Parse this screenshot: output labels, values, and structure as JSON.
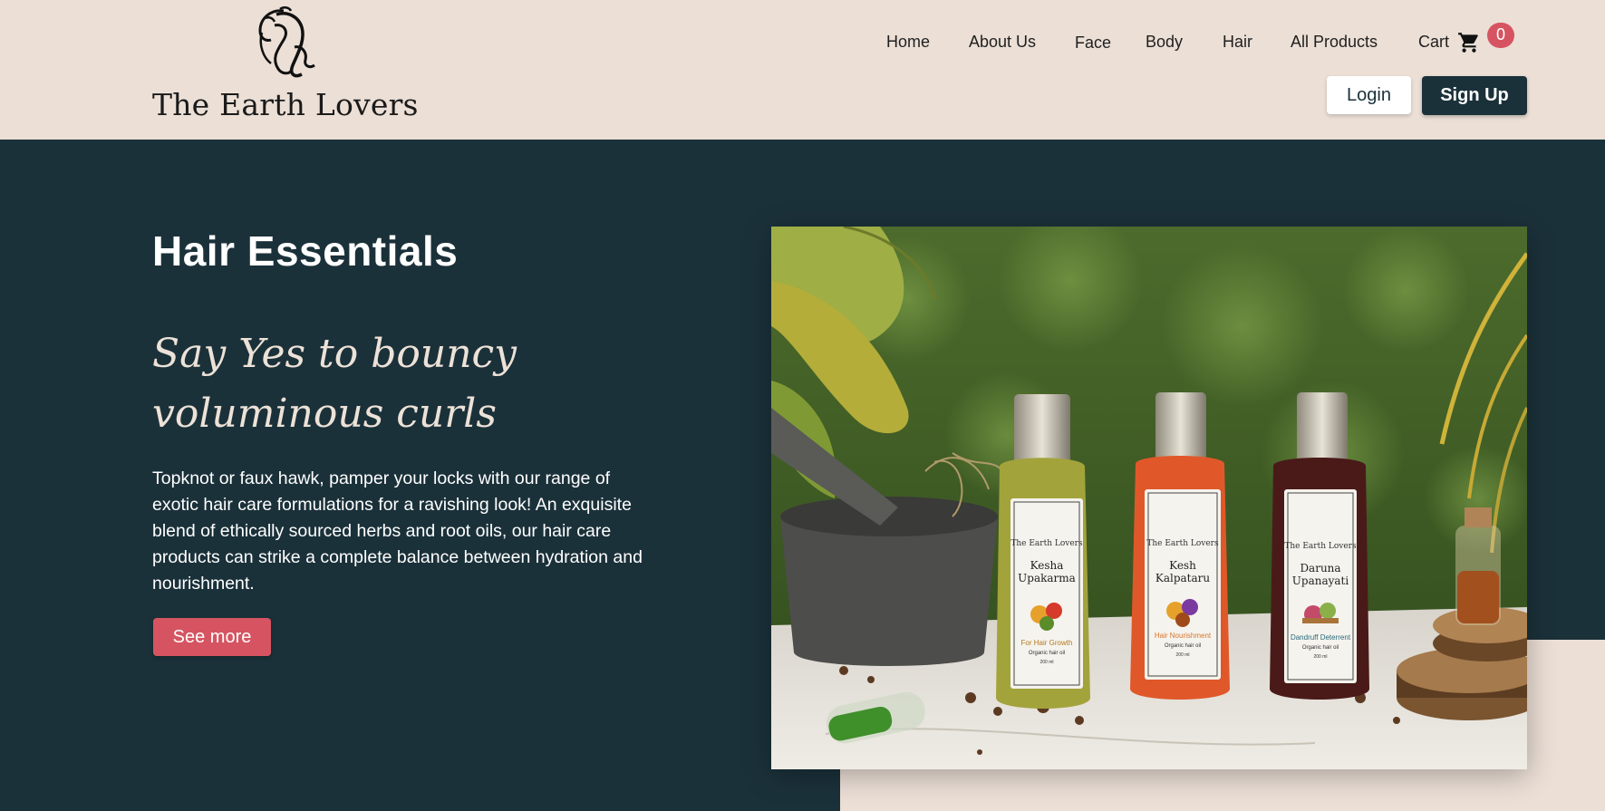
{
  "brand": {
    "name": "The Earth Lovers",
    "logo_icon": "woman-silhouette-logo"
  },
  "nav": {
    "items": [
      "Home",
      "About Us",
      "Face",
      "Body",
      "Hair",
      "All Products"
    ],
    "cart_label": "Cart",
    "cart_icon": "shopping-cart-icon",
    "cart_count": "0"
  },
  "auth": {
    "login_label": "Login",
    "signup_label": "Sign Up"
  },
  "hero": {
    "title": "Hair Essentials",
    "tagline": "Say Yes to bouncy voluminous curls",
    "body": "Topknot or faux hawk, pamper your locks with our range of exotic hair care formulations for a ravishing look! An exquisite blend of ethically sourced herbs and root oils, our hair care products can strike a complete balance between hydration and nourishment.",
    "cta_label": "See more"
  },
  "products": [
    {
      "brand": "The Earth Lovers",
      "name_line1": "Kesha",
      "name_line2": "Upakarma",
      "benefit": "For Hair Growth",
      "type": "Organic hair oil",
      "volume": "200 ml",
      "oil_color": "#a3a33c"
    },
    {
      "brand": "The Earth Lovers",
      "name_line1": "Kesh",
      "name_line2": "Kalpataru",
      "benefit": "Hair Nourishment",
      "type": "Organic hair oil",
      "volume": "200 ml",
      "oil_color": "#e0582a"
    },
    {
      "brand": "The Earth Lovers",
      "name_line1": "Daruna",
      "name_line2": "Upanayati",
      "benefit": "Dandruff Deterrent",
      "type": "Organic hair oil",
      "volume": "200 ml",
      "oil_color": "#4a1a18"
    }
  ],
  "colors": {
    "header_bg": "#ebdfd6",
    "hero_bg": "#1b313a",
    "accent": "#d65461",
    "tagline": "#ede2d8"
  }
}
